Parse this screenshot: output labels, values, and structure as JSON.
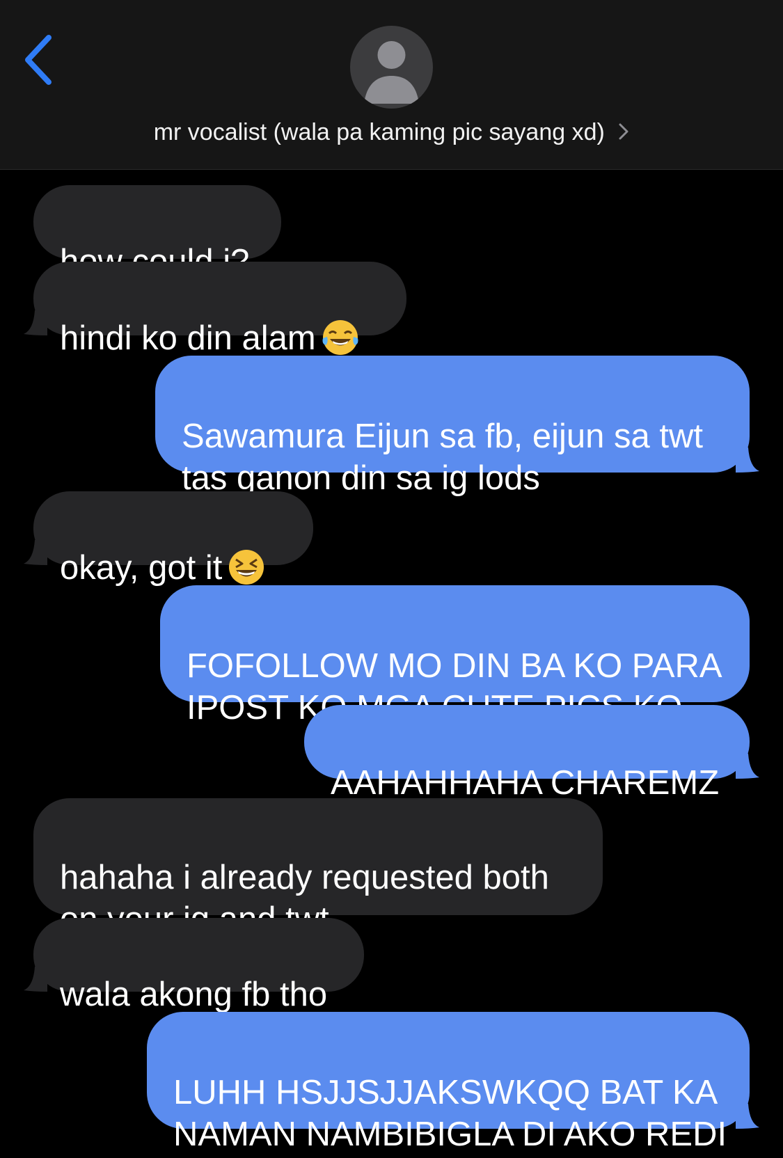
{
  "header": {
    "back_icon": "chevron-left-icon",
    "avatar_icon": "person-icon",
    "contact_name": "mr vocalist (wala pa kaming pic sayang xd)",
    "chevron_icon": "chevron-right-icon",
    "accent_color": "#2f7cf6"
  },
  "colors": {
    "received_bubble": "#262628",
    "sent_bubble": "#5b8cef",
    "background": "#000000"
  },
  "messages": [
    {
      "direction": "received",
      "text": "how could i?"
    },
    {
      "direction": "received",
      "text": "hindi ko din alam",
      "emoji": "😂"
    },
    {
      "direction": "sent",
      "text": "Sawamura Eijun sa fb, eijun sa twt\ntas ganon din sa ig lods"
    },
    {
      "direction": "received",
      "text": "okay, got it",
      "emoji": "😆"
    },
    {
      "direction": "sent",
      "text": "FOFOLLOW MO DIN BA KO PARA\nIPOST KO MGA CUTE PICS KO"
    },
    {
      "direction": "sent",
      "text": "AAHAHHAHA CHAREMZ"
    },
    {
      "direction": "received",
      "text": "hahaha i already requested both\non your ig and twt"
    },
    {
      "direction": "received",
      "text": "wala akong fb tho"
    },
    {
      "direction": "sent",
      "text": "LUHH HSJJSJJAKSWKQQ BAT KA\nNAMAN NAMBIBIGLA DI AKO REDI"
    }
  ]
}
